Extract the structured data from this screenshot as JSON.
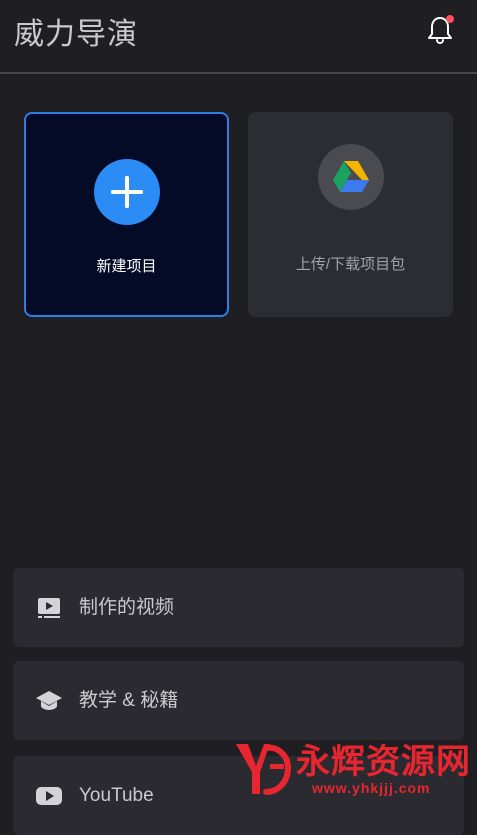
{
  "header": {
    "title": "威力导演",
    "notification_icon": "bell-icon",
    "has_unread": true
  },
  "cards": {
    "new_project": {
      "label": "新建项目",
      "icon": "plus-icon",
      "accent": "#2a8cf4"
    },
    "upload_download": {
      "label": "上传/下载项目包",
      "icon": "google-drive-icon"
    }
  },
  "menu": {
    "items": [
      {
        "label": "制作的视频",
        "icon": "video-list-icon"
      },
      {
        "label": "教学 & 秘籍",
        "icon": "graduation-cap-icon"
      },
      {
        "label": "YouTube",
        "icon": "youtube-icon"
      }
    ]
  },
  "watermark": {
    "text": "永辉资源网",
    "url": "www.yhkjjj.com",
    "color": "#e8262f"
  },
  "colors": {
    "background": "#1f1f23",
    "card_new_bg": "#050b26",
    "card_new_border": "#2f7ee6",
    "card_upload_bg": "#2c2c33",
    "menu_bg": "#2a2a30",
    "notification_dot": "#ff4f5e"
  }
}
